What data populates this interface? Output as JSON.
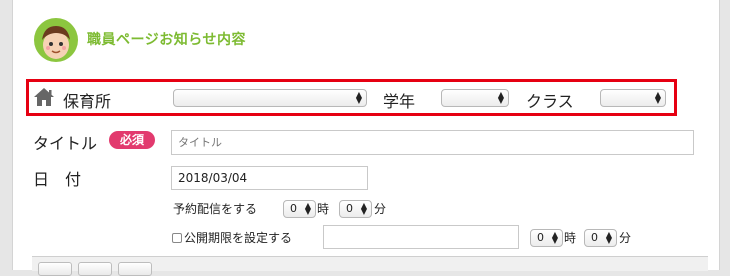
{
  "header": {
    "title": "職員ページお知らせ内容",
    "avatar_icon": "staff-avatar"
  },
  "colors": {
    "title_green": "#7dbb32",
    "highlight_red": "#e60012",
    "required_badge": "#e23a6e"
  },
  "filters": {
    "home_icon": "house-icon",
    "nursery_label": "保育所",
    "nursery_value": "",
    "grade_label": "学年",
    "grade_value": "",
    "class_label": "クラス",
    "class_value": ""
  },
  "form": {
    "title_label": "タイトル",
    "required_badge": "必須",
    "title_placeholder": "タイトル",
    "date_label": "日　付",
    "date_value": "2018/03/04",
    "schedule_label": "予約配信をする",
    "schedule_hour": "0",
    "hour_unit": "時",
    "schedule_minute": "0",
    "minute_unit": "分",
    "period_checkbox_label": "公開期限を設定する",
    "period_checked": false,
    "period_date_value": "",
    "period_hour": "0",
    "period_minute": "0"
  }
}
